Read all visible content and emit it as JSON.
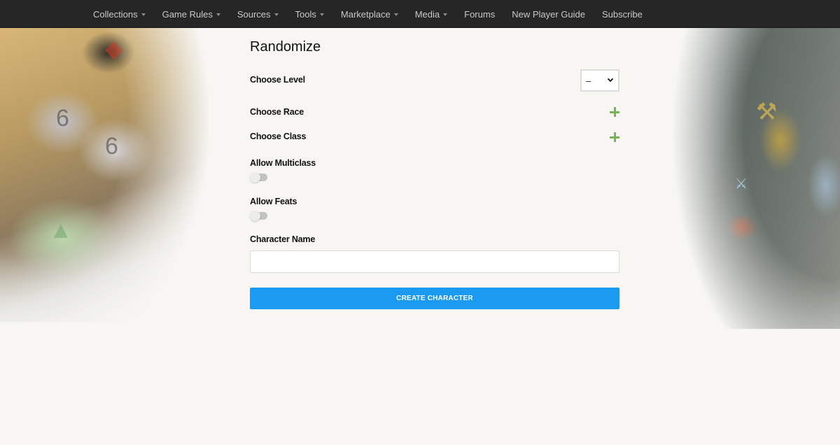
{
  "nav": {
    "items": [
      {
        "label": "Collections",
        "dropdown": true
      },
      {
        "label": "Game Rules",
        "dropdown": true
      },
      {
        "label": "Sources",
        "dropdown": true
      },
      {
        "label": "Tools",
        "dropdown": true
      },
      {
        "label": "Marketplace",
        "dropdown": true
      },
      {
        "label": "Media",
        "dropdown": true
      },
      {
        "label": "Forums",
        "dropdown": false
      },
      {
        "label": "New Player Guide",
        "dropdown": false
      },
      {
        "label": "Subscribe",
        "dropdown": false
      }
    ]
  },
  "form": {
    "title": "Randomize",
    "level": {
      "label": "Choose Level",
      "selected": "–"
    },
    "race": {
      "label": "Choose Race",
      "icon": "plus-icon"
    },
    "class": {
      "label": "Choose Class",
      "icon": "plus-icon"
    },
    "multiclass": {
      "label": "Allow Multiclass",
      "enabled": false
    },
    "feats": {
      "label": "Allow Feats",
      "enabled": false
    },
    "character_name": {
      "label": "Character Name",
      "value": "",
      "placeholder": ""
    },
    "submit_label": "CREATE CHARACTER"
  },
  "colors": {
    "navbar": "#262626",
    "accent_button": "#1a9af0",
    "plus_icon": "#77b255"
  },
  "art": {
    "left": "dice-illustration",
    "right": "adventurers-illustration"
  }
}
